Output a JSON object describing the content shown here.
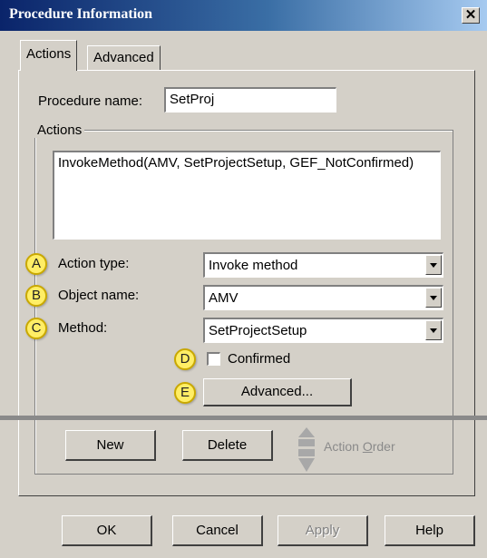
{
  "window": {
    "title": "Procedure Information",
    "close_label": "✕"
  },
  "tabs": [
    {
      "label": "Actions",
      "active": true
    },
    {
      "label": "Advanced",
      "active": false
    }
  ],
  "procedure": {
    "label": "Procedure name:",
    "value": "SetProj"
  },
  "actions_group": {
    "legend": "Actions",
    "list_items": [
      "InvokeMethod(AMV, SetProjectSetup, GEF_NotConfirmed)"
    ]
  },
  "fields": {
    "action_type": {
      "label": "Action type:",
      "value": "Invoke method",
      "callout": "A"
    },
    "object_name": {
      "label": "Object name:",
      "value": "AMV",
      "callout": "B"
    },
    "method": {
      "label": "Method:",
      "value": "SetProjectSetup",
      "callout": "C"
    }
  },
  "confirmed": {
    "label": "Confirmed",
    "checked": false,
    "callout": "D"
  },
  "advanced_button": {
    "label": "Advanced...",
    "callout": "E"
  },
  "action_buttons": {
    "new": "New",
    "delete": "Delete"
  },
  "action_order": {
    "prefix": "Action ",
    "hotkey": "O",
    "suffix": "rder"
  },
  "footer": {
    "ok": "OK",
    "cancel": "Cancel",
    "apply": "Apply",
    "help": "Help"
  }
}
